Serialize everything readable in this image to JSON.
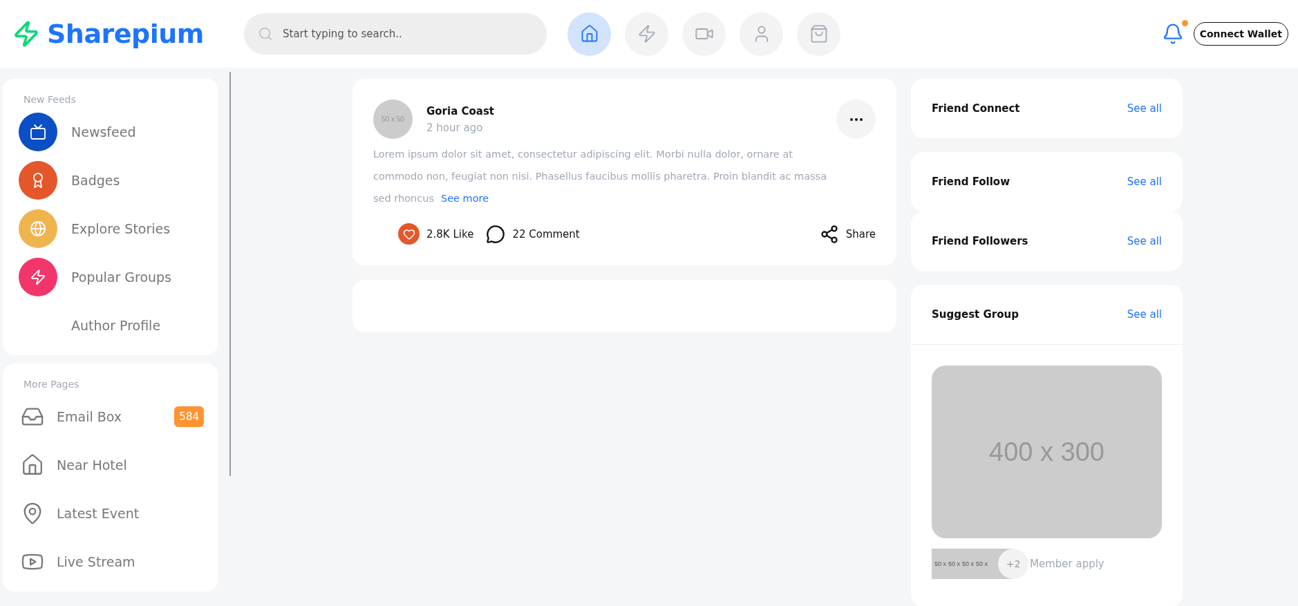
{
  "header": {
    "logo": "Sharepium",
    "search": {
      "placeholder": "Start typing to search.."
    },
    "nav": [
      {
        "selected": true
      },
      {
        "selected": false
      },
      {
        "selected": false
      },
      {
        "selected": false
      },
      {
        "selected": false
      }
    ],
    "notifications": {
      "unread": true
    },
    "connect_button": "Connect Wallet"
  },
  "sidebar": {
    "sections": [
      {
        "title": "New Feeds",
        "items": [
          {
            "label": "Newsfeed",
            "kind": "round",
            "color": "#0a4fc4"
          },
          {
            "label": "Badges",
            "kind": "round",
            "color": "#e5572b"
          },
          {
            "label": "Explore Stories",
            "kind": "round",
            "color": "#f0b44f"
          },
          {
            "label": "Popular Groups",
            "kind": "round",
            "color": "#f2366a"
          },
          {
            "label": "Author Profile",
            "kind": "plain"
          }
        ]
      },
      {
        "title": "More Pages",
        "items": [
          {
            "label": "Email Box",
            "kind": "outline",
            "badge": "584"
          },
          {
            "label": "Near Hotel",
            "kind": "outline"
          },
          {
            "label": "Latest Event",
            "kind": "outline"
          },
          {
            "label": "Live Stream",
            "kind": "outline"
          }
        ]
      }
    ]
  },
  "feed": {
    "posts": [
      {
        "kind": "full",
        "author": "Goria Coast",
        "avatar": "50 x 50",
        "time": "2 hour ago",
        "text": "Lorem ipsum dolor sit amet, consectetur adipiscing elit. Morbi nulla dolor, ornare at commodo non, feugiat non nisi. Phasellus faucibus mollis pharetra. Proin blandit ac massa sed rhoncus",
        "more_link": "See more",
        "likes": "2.8K Like",
        "comments": "22 Comment",
        "share": "Share"
      },
      {
        "kind": "empty"
      }
    ]
  },
  "right": {
    "cards": [
      {
        "title": "Friend Connect",
        "link": "See all"
      },
      {
        "title": "Friend Follow",
        "link": "See all"
      },
      {
        "title": "Friend Followers",
        "link": "See all"
      },
      {
        "title": "Suggest Group",
        "link": "See all",
        "group": {
          "image": "400 x 300",
          "members": [
            "50 x",
            "50 x",
            "50 x",
            "50 x"
          ],
          "extra": "+2",
          "caption": "Member apply"
        }
      }
    ]
  }
}
